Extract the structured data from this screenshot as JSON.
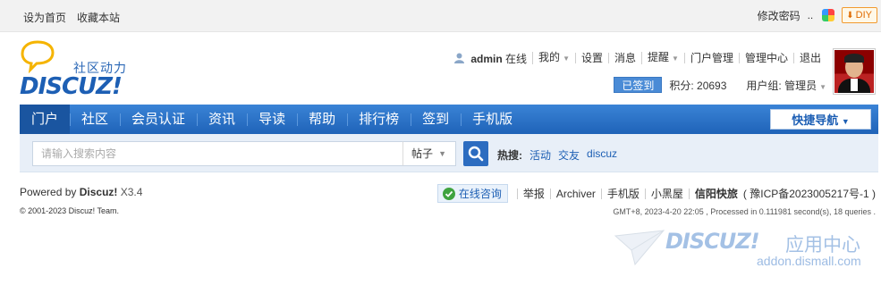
{
  "topbar": {
    "set_home": "设为首页",
    "bookmark": "收藏本站",
    "change_password": "修改密码",
    "dots": "..",
    "diy": "DIY"
  },
  "logo": {
    "tagline": "社区动力",
    "wordmark": "DISCUZ!"
  },
  "user": {
    "name": "admin",
    "status": "在线",
    "menu": [
      "我的",
      "设置",
      "消息",
      "提醒",
      "门户管理",
      "管理中心",
      "退出"
    ],
    "signed_label": "已签到",
    "points": "积分: 20693",
    "group": "用户组: 管理员"
  },
  "nav": {
    "items": [
      "门户",
      "社区",
      "会员认证",
      "资讯",
      "导读",
      "帮助",
      "排行榜",
      "签到",
      "手机版"
    ],
    "active_index": 0,
    "quick_nav": "快捷导航"
  },
  "search": {
    "placeholder": "请输入搜索内容",
    "type": "帖子",
    "hot_label": "热搜:",
    "hot_keywords": [
      "活动",
      "交友",
      "discuz"
    ]
  },
  "footer": {
    "powered_prefix": "Powered by",
    "powered_brand": "Discuz!",
    "version": "X3.4",
    "copyright": "© 2001-2023 Discuz! Team.",
    "consult": "在线咨询",
    "links": [
      "举报",
      "Archiver",
      "手机版",
      "小黑屋"
    ],
    "site_name": "信阳快旅",
    "icp": "( 豫ICP备2023005217号-1 )",
    "gmt": "GMT+8, 2023-4-20 22:05 , Processed in 0.111981 second(s), 18 queries ."
  },
  "watermark": {
    "brand": "DISCUZ!",
    "center": "应用中心",
    "url": "addon.dismall.com"
  },
  "colors": {
    "nav_blue": "#1f63b8",
    "brand_blue": "#1d5fb4",
    "search_bg": "#e8eff8",
    "diy_orange": "#f29a2e"
  }
}
